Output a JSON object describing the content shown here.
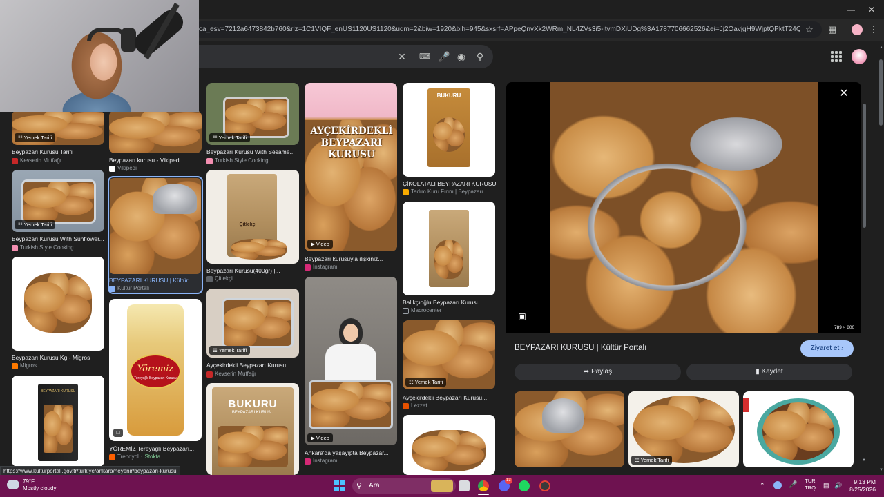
{
  "browser": {
    "url": "ca_esv=7212a6473842b760&rlz=1C1VIQF_enUS1120US1120&udm=2&biw=1920&bih=945&sxsrf=APpeQnvXk2WRm_NL4ZVs3i5-jtvmDXiUDg%3A1787706662526&ei=Jj2OavjgH9WjptQPktT24Qc&ved=0ahUKE...",
    "status_url": "https://www.kulturportali.gov.tr/turkiye/ankara/neyenir/beypazari-kurusu"
  },
  "icons": {
    "minimize": "minimize-icon",
    "maximize": "maximize-icon",
    "close": "close-icon",
    "search_clear": "close-icon",
    "keyboard": "keyboard-icon",
    "mic": "mic-icon",
    "lens": "lens-icon",
    "search": "search-icon",
    "apps": "apps-grid-icon"
  },
  "results": [
    {
      "caption": "Beypazarı Kurusu Tarifi",
      "source": "Kevserin Mutfağı",
      "tag": "Yemek Tarifi",
      "fav": "#c62828"
    },
    {
      "caption": "Beypazarı Kurusu With Sunflower...",
      "source": "Turkish Style Cooking",
      "tag": "Yemek Tarifi",
      "fav": "#f48fb1"
    },
    {
      "caption": "Beypazarı Kurusu Kg - Migros",
      "source": "Migros",
      "tag": "",
      "fav": "#ff7a00"
    },
    {
      "caption": "Beypazarı kurusu - Vikipedi",
      "source": "Vikipedi",
      "tag": "",
      "fav": "#ffffff"
    },
    {
      "caption": "BEYPAZARI KURUSU | Kültür...",
      "source": "Kültür Portalı",
      "tag": "",
      "fav": "#8ab4f8"
    },
    {
      "caption": "YÖREMİZ Tereyağlı Beypazarı...",
      "source": "Trendyol",
      "source_extra": "Stokta",
      "tag": "",
      "fav": "#ff6000"
    },
    {
      "caption": "Beypazarı Kurusu With Sesame...",
      "source": "Turkish Style Cooking",
      "tag": "Yemek Tarifi",
      "fav": "#f48fb1"
    },
    {
      "caption": "Beypazarı Kurusu(400gr) |...",
      "source": "Çitlekçi",
      "tag": "",
      "fav": "#5f6368"
    },
    {
      "caption": "Ayçekirdekli Beypazarı Kurusu...",
      "source": "Kevserin Mutfağı",
      "tag": "Yemek Tarifi",
      "fav": "#c62828"
    },
    {
      "caption": "Beypazarı kurusuyla ilişkiniz...",
      "source": "Instagram",
      "tag": "Video",
      "fav": "#d62976"
    },
    {
      "caption": "Ankara'da yaşayıpta Beypazar...",
      "source": "Instagram",
      "tag": "Video",
      "fav": "#d62976"
    },
    {
      "caption": "ÇİKOLATALI BEYPAZARI KURUSU...",
      "source": "Tadım Kuru Fırını | Beypazarı...",
      "tag": "",
      "fav": "#f9ab00"
    },
    {
      "caption": "Balıkçıoğlu Beypazarı Kurusu...",
      "source": "Macrocenter",
      "tag": "",
      "fav": "#202124"
    },
    {
      "caption": "Ayçekirdekli Beypazarı Kurusu...",
      "source": "Lezzet",
      "tag": "Yemek Tarifi",
      "fav": "#e65100"
    }
  ],
  "thumb_text": {
    "aycek_overlay": "AYÇEKİRDEKLİ BEYPAZARI KURUSU",
    "bukuru_1": "BUKURU",
    "bukuru_2": "BUKURU",
    "bukuru_3": "BEYPAZARI KURUSU",
    "yoremiz": "Yöremiz",
    "yoremiz_sub": "Tereyağlı Beypazarı Kurusu",
    "citlekci": "Çitlekçi",
    "beypazari_small": "BEYPAZARI KURUSU"
  },
  "panel": {
    "title": "BEYPAZARI KURUSU | Kültür Portalı",
    "visit": "Ziyaret et",
    "share": "Paylaş",
    "save": "Kaydet",
    "dims": "789 × 800",
    "related_tag": "Yemek Tarifi"
  },
  "taskbar": {
    "temp": "79°F",
    "weather": "Mostly cloudy",
    "search": "Ara",
    "lang1": "TUR",
    "lang2": "TRQ",
    "time": "9:13 PM",
    "date": "8/25/2026",
    "discord_badge": "13"
  }
}
